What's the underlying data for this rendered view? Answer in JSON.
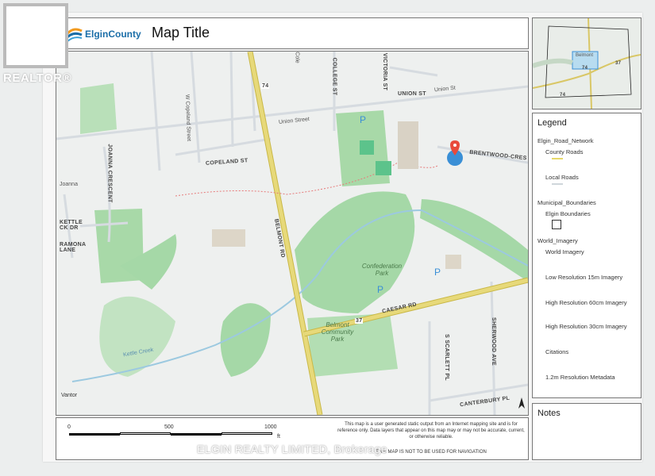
{
  "watermark": {
    "brand": "REALTOR®",
    "broker": "ELGIN REALTY LIMITED, Brokerage"
  },
  "header": {
    "logo_text": "ElginCounty",
    "map_title": "Map Title"
  },
  "map": {
    "streets": {
      "union_st": "UNION ST",
      "union_street": "Union Street",
      "union_st_right": "Union St",
      "college_st": "COLLEGE ST",
      "victoria_st": "VICTORIA ST",
      "cole": "Cole",
      "copeland_st": "COPELAND ST",
      "w_copeland": "W Copeland Street",
      "joanna_crescent": "JOANNA CRESCENT",
      "joanna": "Joanna",
      "kettle_ck_dr": "KETTLE CK DR",
      "ramona_lane": "RAMONA LANE",
      "belmont_rd": "BELMONT RD",
      "brentwood": "BRENTWOOD-CRES C",
      "caesar_rd": "CAESAR RD",
      "sherwood_ave": "SHERWOOD AVE",
      "scarlett_pl": "S SCARLETT PL",
      "canterbury_pl": "CANTERBURY PL",
      "hwy_74": "74",
      "hwy_37": "37",
      "kettle_creek": "Kettle Creek"
    },
    "parks": {
      "confederation": "Confederation Park",
      "belmont_community": "Belmont Community Park"
    },
    "attribution": "Vantor",
    "north_arrow": "north-arrow-icon"
  },
  "overview": {
    "place": "Belmont",
    "labels": [
      "74",
      "37",
      "74"
    ]
  },
  "legend": {
    "title": "Legend",
    "items": [
      "Elgin_Road_Network",
      "County Roads",
      "Local Roads",
      "Municipal_Boundaries",
      "Elgin Boundaries",
      "World_Imagery",
      "World Imagery",
      "Low Resolution 15m Imagery",
      "High Resolution 60cm Imagery",
      "High Resolution 30cm Imagery",
      "Citations",
      "1.2m Resolution Metadata"
    ],
    "colors": {
      "county_road": "#e6d86a",
      "local_road": "#cfd6db"
    }
  },
  "notes": {
    "title": "Notes"
  },
  "scale": {
    "ticks": [
      "0",
      "500",
      "1000"
    ],
    "unit": "ft"
  },
  "disclaimer": "This map is a user generated static output from an Internet mapping site and is for reference only. Data layers that appear on this map may or may not be accurate, current, or otherwise reliable.",
  "navigation_warning": "THIS MAP IS NOT TO BE USED FOR NAVIGATION",
  "colors": {
    "park": "#9fd4a4",
    "park_light": "#c9e7c9",
    "water": "#9cc9e0",
    "pin": "#e84a3b",
    "highway": "#e2d15f"
  }
}
